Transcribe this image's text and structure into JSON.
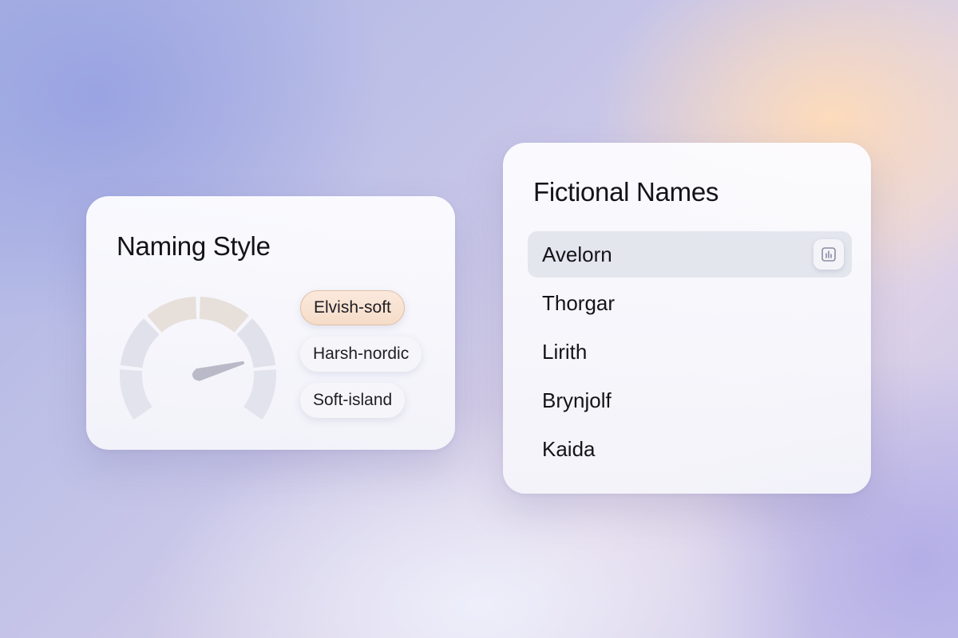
{
  "style_card": {
    "title": "Naming Style",
    "gauge": {
      "value": 0.8,
      "segment_count": 6
    },
    "options": [
      {
        "label": "Elvish-soft",
        "selected": true
      },
      {
        "label": "Harsh-nordic",
        "selected": false
      },
      {
        "label": "Soft-island",
        "selected": false
      }
    ]
  },
  "names_card": {
    "title": "Fictional Names",
    "items": [
      {
        "label": "Avelorn",
        "selected": true,
        "action_icon": "bar-chart-icon"
      },
      {
        "label": "Thorgar",
        "selected": false
      },
      {
        "label": "Lirith",
        "selected": false
      },
      {
        "label": "Brynjolf",
        "selected": false
      },
      {
        "label": "Kaida",
        "selected": false
      }
    ]
  },
  "colors": {
    "selected_chip_bg": "#f7dfcc",
    "selected_row_bg": "#e4e6ee",
    "gauge_segment_cool": "#dcdde8",
    "gauge_segment_warm": "#e6ddd8",
    "gauge_needle": "#b9b9c7"
  }
}
